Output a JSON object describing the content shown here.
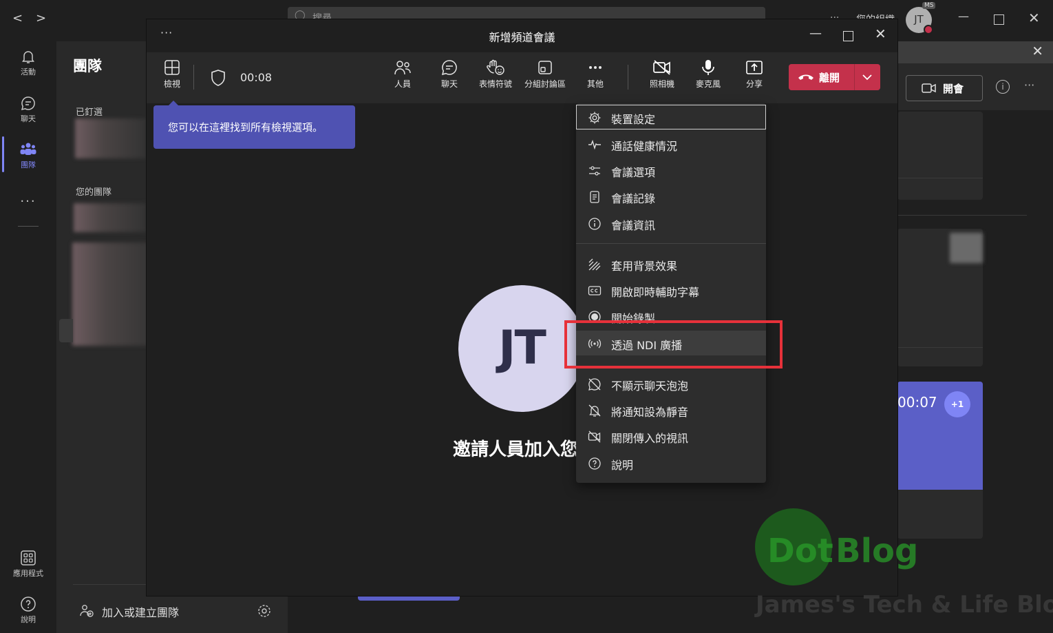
{
  "rail": {
    "items": [
      {
        "label": "活動",
        "icon": "bell-icon"
      },
      {
        "label": "聊天",
        "icon": "chat-icon"
      },
      {
        "label": "團隊",
        "icon": "teams-icon"
      },
      {
        "label": "應用程式",
        "icon": "apps-icon"
      },
      {
        "label": "說明",
        "icon": "help-icon"
      }
    ]
  },
  "teams_panel": {
    "title": "團隊",
    "pinned_label": "已釘選",
    "your_teams_label": "您的團隊",
    "join_create_label": "加入或建立團隊"
  },
  "topbar": {
    "search_placeholder": "搜尋",
    "org_label": "您的組織",
    "avatar_initials": "JT",
    "avatar_badge": "MS"
  },
  "right_panel": {
    "meet_button": "開會",
    "timer_card": "00:07",
    "plus_badge": "+1"
  },
  "meeting": {
    "title": "新增頻道會議",
    "more_label": "···",
    "elapsed": "00:08",
    "toolbar": {
      "view": "檢視",
      "people": "人員",
      "chat": "聊天",
      "reactions": "表情符號",
      "breakout": "分組討論區",
      "more": "其他",
      "camera": "照相機",
      "mic": "麥克風",
      "share": "分享",
      "leave": "離開"
    },
    "tooltip": "您可以在這裡找到所有檢視選項。",
    "avatar_initials": "JT",
    "invite_text": "邀請人員加入您的會議"
  },
  "menu": {
    "items": [
      {
        "label": "裝置設定",
        "icon": "gear-icon"
      },
      {
        "label": "通話健康情況",
        "icon": "pulse-icon"
      },
      {
        "label": "會議選項",
        "icon": "sliders-icon"
      },
      {
        "label": "會議記錄",
        "icon": "notes-icon"
      },
      {
        "label": "會議資訊",
        "icon": "info-icon"
      },
      {
        "label": "套用背景效果",
        "icon": "background-effects-icon"
      },
      {
        "label": "開啟即時輔助字幕",
        "icon": "captions-icon"
      },
      {
        "label": "開始錄製",
        "icon": "record-icon"
      },
      {
        "label": "透過 NDI 廣播",
        "icon": "broadcast-icon"
      },
      {
        "label": "不顯示聊天泡泡",
        "icon": "chat-bubble-off-icon"
      },
      {
        "label": "將通知設為靜音",
        "icon": "bell-off-icon"
      },
      {
        "label": "關閉傳入的視訊",
        "icon": "video-off-icon"
      },
      {
        "label": "說明",
        "icon": "help-icon"
      }
    ]
  },
  "watermark": {
    "brand_dot": "Dot",
    "brand_blog": "Blog",
    "tagline": "James's Tech & Life Blog"
  },
  "colors": {
    "accent": "#7f85f5",
    "tooltip_bg": "#4f52b2",
    "leave_red": "#c4314b",
    "highlight_frame": "#e6313a",
    "watermark_green": "#2aa12a"
  }
}
